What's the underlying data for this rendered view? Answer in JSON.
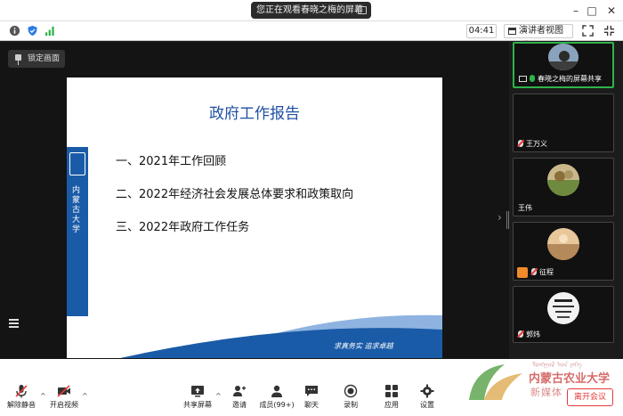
{
  "window": {
    "share_banner": "您正在观看春晓之梅的屏幕",
    "controls": {
      "minimize": "–",
      "maximize": "□",
      "close": "✕"
    }
  },
  "infobar": {
    "timer": "04:41",
    "view_button": "演讲者视图",
    "view_caret": "▾"
  },
  "stage": {
    "lock_button": "锁定画面",
    "arrow": "›"
  },
  "slide": {
    "title": "政府工作报告",
    "items": [
      "一、2021年工作回顾",
      "二、2022年经济社会发展总体要求和政策取向",
      "三、2022年政府工作任务"
    ],
    "side_text": "内蒙古大学",
    "footer": "求真务实  追求卓越"
  },
  "participants": [
    {
      "name": "春晓之梅的屏幕共享",
      "active": true
    },
    {
      "name": "王万义",
      "active": false
    },
    {
      "name": "王伟",
      "active": false
    },
    {
      "name": "征程",
      "active": false
    },
    {
      "name": "郭炜",
      "active": false
    }
  ],
  "toolbar": {
    "unmute": "解除静音",
    "start_video": "开启视频",
    "share_screen": "共享屏幕",
    "invite": "邀请",
    "members": "成员(99+)",
    "chat": "聊天",
    "record": "录制",
    "apps": "应用",
    "settings": "设置",
    "leave": "离开会议"
  },
  "watermark": {
    "line1": "ᠮᠣᠩᠭᠣᠯ ᠤᠨ ᠶᠡᠬᠡ",
    "line2": "内蒙古农业大学",
    "line3": "新媒体"
  },
  "colors": {
    "slide_title": "#1f4fa3",
    "slide_band": "#1a5ba8",
    "active_border": "#2fb34a",
    "leave": "#e53a3a"
  }
}
